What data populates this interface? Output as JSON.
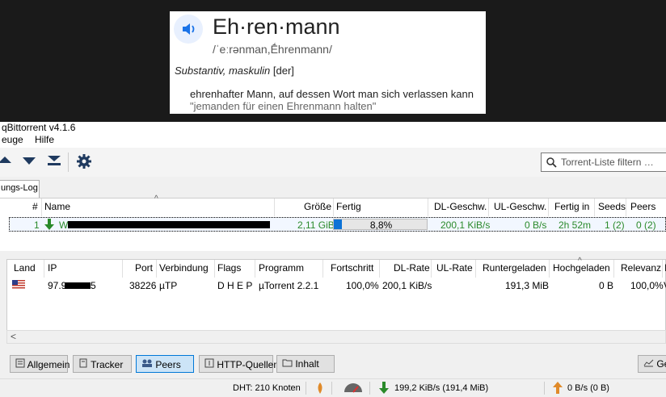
{
  "dictionary": {
    "word": "Eh·ren·mann",
    "phonetic": "/ˈeːrənman,Ḗhrenmann/",
    "part_of_speech": "Substantiv, maskulin",
    "article": "[der]",
    "definition": "ehrenhafter Mann, auf dessen Wort man sich verlassen kann",
    "example": "\"jemanden für einen Ehrenmann halten\""
  },
  "app": {
    "title": "qBittorrent v4.1.6",
    "menu": [
      "euge",
      "Hilfe"
    ],
    "filter_placeholder": "Torrent-Liste filtern …",
    "log_tab": "ungs-Log"
  },
  "torrent_table": {
    "headers": [
      "#",
      "Name",
      "Größe",
      "Fertig",
      "DL-Geschw.",
      "UL-Geschw.",
      "Fertig in",
      "Seeds",
      "Peers"
    ],
    "row": {
      "num": "1",
      "name_prefix": "W",
      "size": "2,11 GiB",
      "progress_text": "8,8%",
      "progress": 0.088,
      "dl_speed": "200,1 KiB/s",
      "ul_speed": "0 B/s",
      "eta": "2h 52m",
      "seeds": "1 (2)",
      "peers": "0 (2)"
    }
  },
  "peers_table": {
    "headers": [
      "Land",
      "IP",
      "Port",
      "Verbindung",
      "Flags",
      "Programm",
      "Fortschritt",
      "DL-Rate",
      "UL-Rate",
      "Runtergeladen",
      "Hochgeladen",
      "Relevanz",
      "I"
    ],
    "row": {
      "ip_prefix": "97.9",
      "ip_suffix": "5",
      "port": "38226",
      "connection": "µTP",
      "flags": "D H E P",
      "client": "µTorrent 2.2.1",
      "progress": "100,0%",
      "dl_rate": "200,1 KiB/s",
      "ul_rate": "",
      "downloaded": "191,3 MiB",
      "uploaded": "0 B",
      "relevance": "100,0%",
      "extra": "V"
    }
  },
  "bottom_tabs": [
    "Allgemein",
    "Tracker",
    "Peers",
    "HTTP-Quellen",
    "Inhalt",
    "Ge"
  ],
  "status": {
    "dht": "DHT: 210 Knoten",
    "download": "199,2 KiB/s (191,4 MiB)",
    "upload": "0 B/s (0 B)"
  },
  "colors": {
    "accent": "#0c72d6",
    "downloading": "#2a8a2a",
    "upload_arrow": "#e08a2a"
  }
}
